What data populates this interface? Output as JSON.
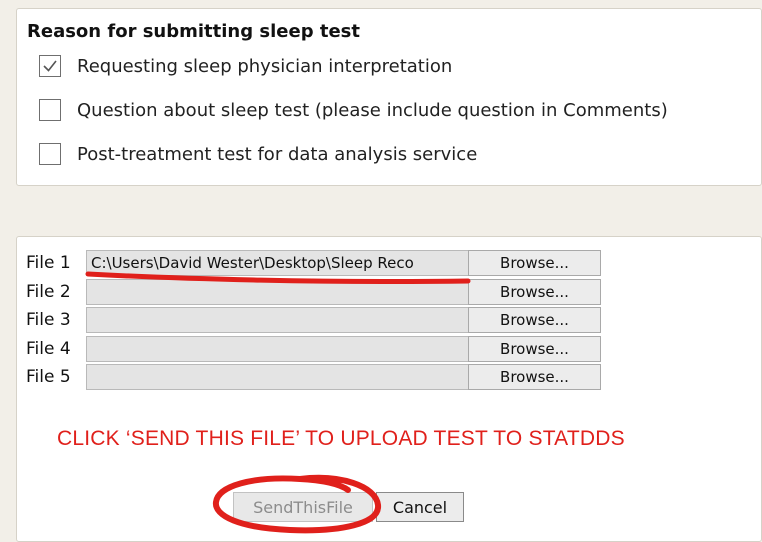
{
  "reason": {
    "title": "Reason for submitting sleep test",
    "options": [
      {
        "label": "Requesting sleep physician interpretation",
        "checked": true
      },
      {
        "label": "Question about sleep test (please include question in Comments)",
        "checked": false
      },
      {
        "label": "Post-treatment test for data analysis service",
        "checked": false
      }
    ]
  },
  "files": [
    {
      "label": "File 1",
      "value": "C:\\Users\\David Wester\\Desktop\\Sleep Reco",
      "browse": "Browse..."
    },
    {
      "label": "File 2",
      "value": "",
      "browse": "Browse..."
    },
    {
      "label": "File 3",
      "value": "",
      "browse": "Browse..."
    },
    {
      "label": "File 4",
      "value": "",
      "browse": "Browse..."
    },
    {
      "label": "File 5",
      "value": "",
      "browse": "Browse..."
    }
  ],
  "instruction": "CLICK ‘SEND THIS FILE’ TO UPLOAD TEST TO STATDDS",
  "buttons": {
    "send": "SendThisFile",
    "cancel": "Cancel"
  },
  "colors": {
    "annotation": "#e0201b",
    "instruction": "#e0201b",
    "page_background": "#f2efe8"
  }
}
